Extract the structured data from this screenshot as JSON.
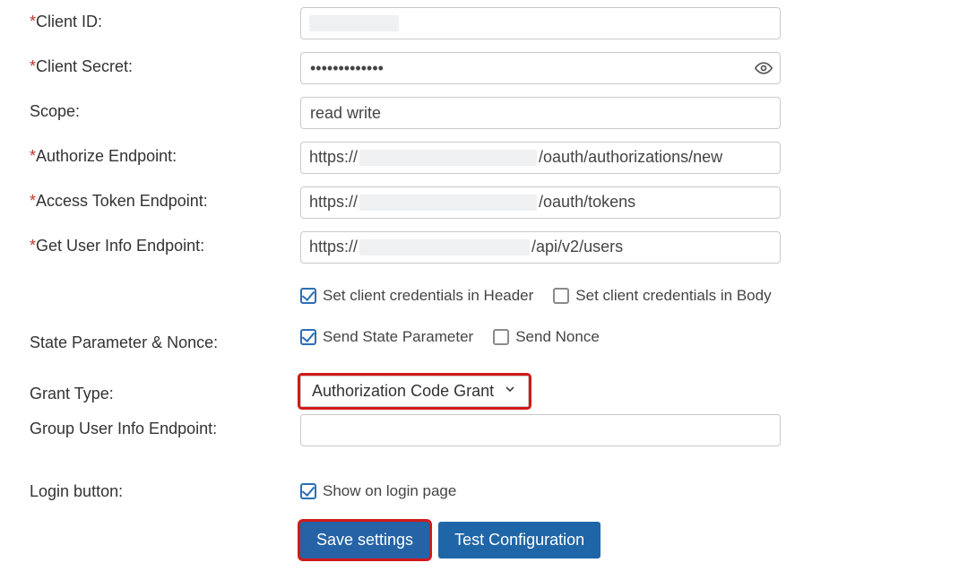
{
  "fields": {
    "client_id": {
      "label": "Client ID:",
      "required": true,
      "value": ""
    },
    "client_secret": {
      "label": "Client Secret:",
      "required": true,
      "value": "•••••••••••••"
    },
    "scope": {
      "label": "Scope:",
      "required": false,
      "value": "read write"
    },
    "authorize_ep": {
      "label": "Authorize Endpoint:",
      "required": true,
      "prefix": "https://",
      "suffix": "/oauth/authorizations/new"
    },
    "token_ep": {
      "label": "Access Token Endpoint:",
      "required": true,
      "prefix": "https://",
      "suffix": "/oauth/tokens"
    },
    "userinfo_ep": {
      "label": "Get User Info Endpoint:",
      "required": true,
      "prefix": "https://",
      "suffix": "/api/v2/users"
    },
    "group_ep": {
      "label": "Group User Info Endpoint:",
      "required": false,
      "value": ""
    }
  },
  "cred_location": {
    "header": {
      "label": "Set client credentials in Header",
      "checked": true
    },
    "body": {
      "label": "Set client credentials in Body",
      "checked": false
    }
  },
  "state_nonce": {
    "section_label": "State Parameter & Nonce:",
    "send_state": {
      "label": "Send State Parameter",
      "checked": true
    },
    "send_nonce": {
      "label": "Send Nonce",
      "checked": false
    }
  },
  "grant_type": {
    "label": "Grant Type:",
    "selected": "Authorization Code Grant"
  },
  "login_button": {
    "label": "Login button:",
    "show_on_login": {
      "label": "Show on login page",
      "checked": true
    }
  },
  "buttons": {
    "save": "Save settings",
    "test": "Test Configuration"
  }
}
